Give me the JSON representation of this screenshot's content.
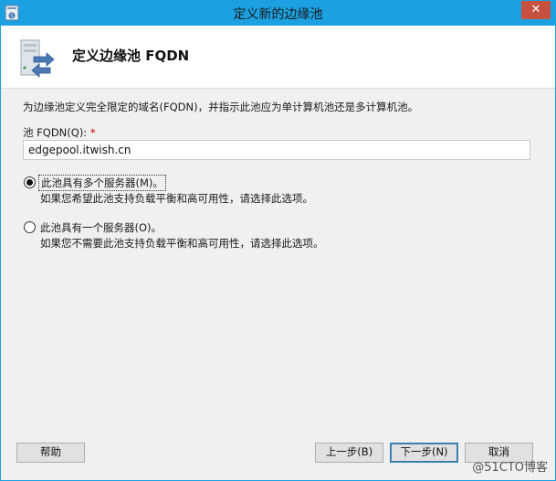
{
  "window": {
    "title": "定义新的边缘池",
    "close_label": "✕"
  },
  "header": {
    "title": "定义边缘池 FQDN",
    "icon": "server-arrows-icon"
  },
  "description": "为边缘池定义完全限定的域名(FQDN)，并指示此池应为单计算机池还是多计算机池。",
  "fqdn": {
    "label": "池 FQDN(Q):",
    "required_mark": "*",
    "value": "edgepool.itwish.cn"
  },
  "options": [
    {
      "label": "此池具有多个服务器(M)。",
      "description": "如果您希望此池支持负载平衡和高可用性，请选择此选项。",
      "selected": true
    },
    {
      "label": "此池具有一个服务器(O)。",
      "description": "如果您不需要此池支持负载平衡和高可用性，请选择此选项。",
      "selected": false
    }
  ],
  "buttons": {
    "help": "帮助",
    "back": "上一步(B)",
    "next": "下一步(N)",
    "cancel": "取消"
  },
  "watermark": "@51CTO博客",
  "colors": {
    "titlebar": "#1ba1e2",
    "close": "#c7503f",
    "required": "#c00000"
  }
}
